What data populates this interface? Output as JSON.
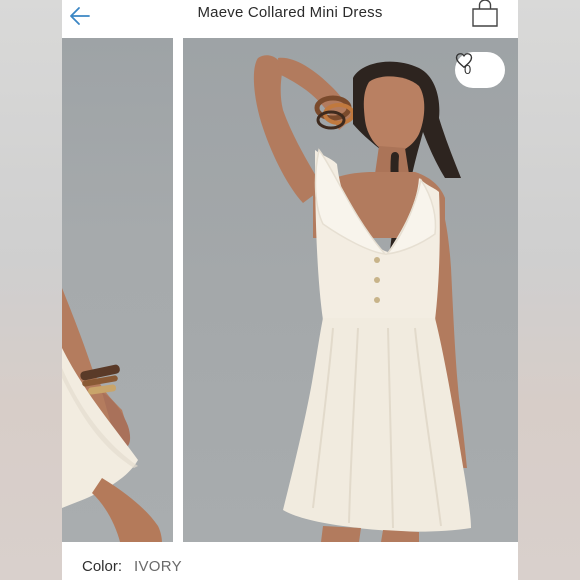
{
  "header": {
    "title": "Maeve Collared Mini Dress",
    "back_icon": "arrow-left-icon",
    "bag_icon": "shopping-bag-icon"
  },
  "favorite": {
    "count": "0",
    "icon": "heart-outline-icon"
  },
  "color": {
    "label": "Color:",
    "value": "IVORY"
  },
  "colors": {
    "accent": "#3b86c4",
    "text": "#2b2b2b",
    "background": "#ffffff"
  }
}
